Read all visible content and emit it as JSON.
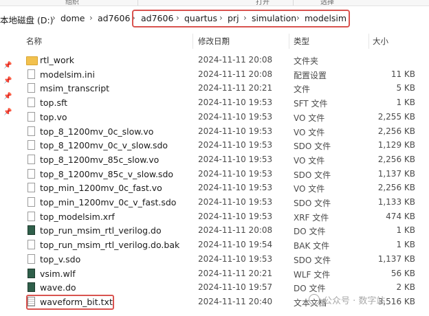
{
  "ribbon": {
    "groups": [
      "组织",
      "打开",
      "选择"
    ]
  },
  "breadcrumb": {
    "items": [
      "本地磁盘 (D:)",
      "dome",
      "ad7606",
      "ad7606",
      "quartus",
      "prj",
      "simulation",
      "modelsim"
    ]
  },
  "columns": {
    "name": "名称",
    "date": "修改日期",
    "type": "类型",
    "size": "大小"
  },
  "files": [
    {
      "name": "rtl_work",
      "date": "2024-11-11 20:08",
      "type": "文件夹",
      "size": "",
      "icon": "folder-icon"
    },
    {
      "name": "modelsim.ini",
      "date": "2024-11-11 20:08",
      "type": "配置设置",
      "size": "11 KB",
      "icon": "file-icon"
    },
    {
      "name": "msim_transcript",
      "date": "2024-11-11 20:21",
      "type": "文件",
      "size": "5 KB",
      "icon": "file-icon"
    },
    {
      "name": "top.sft",
      "date": "2024-11-10 19:53",
      "type": "SFT 文件",
      "size": "1 KB",
      "icon": "file-icon"
    },
    {
      "name": "top.vo",
      "date": "2024-11-10 19:53",
      "type": "VO 文件",
      "size": "2,255 KB",
      "icon": "file-icon"
    },
    {
      "name": "top_8_1200mv_0c_slow.vo",
      "date": "2024-11-10 19:53",
      "type": "VO 文件",
      "size": "2,256 KB",
      "icon": "file-icon"
    },
    {
      "name": "top_8_1200mv_0c_v_slow.sdo",
      "date": "2024-11-10 19:53",
      "type": "SDO 文件",
      "size": "1,129 KB",
      "icon": "file-icon"
    },
    {
      "name": "top_8_1200mv_85c_slow.vo",
      "date": "2024-11-10 19:53",
      "type": "VO 文件",
      "size": "2,256 KB",
      "icon": "file-icon"
    },
    {
      "name": "top_8_1200mv_85c_v_slow.sdo",
      "date": "2024-11-10 19:53",
      "type": "SDO 文件",
      "size": "1,137 KB",
      "icon": "file-icon"
    },
    {
      "name": "top_min_1200mv_0c_fast.vo",
      "date": "2024-11-10 19:53",
      "type": "VO 文件",
      "size": "2,256 KB",
      "icon": "file-icon"
    },
    {
      "name": "top_min_1200mv_0c_v_fast.sdo",
      "date": "2024-11-10 19:53",
      "type": "SDO 文件",
      "size": "1,133 KB",
      "icon": "file-icon"
    },
    {
      "name": "top_modelsim.xrf",
      "date": "2024-11-10 19:53",
      "type": "XRF 文件",
      "size": "474 KB",
      "icon": "file-icon"
    },
    {
      "name": "top_run_msim_rtl_verilog.do",
      "date": "2024-11-11 20:08",
      "type": "DO 文件",
      "size": "1 KB",
      "icon": "script-icon"
    },
    {
      "name": "top_run_msim_rtl_verilog.do.bak",
      "date": "2024-11-10 19:54",
      "type": "BAK 文件",
      "size": "1 KB",
      "icon": "file-icon"
    },
    {
      "name": "top_v.sdo",
      "date": "2024-11-10 19:53",
      "type": "SDO 文件",
      "size": "1,137 KB",
      "icon": "file-icon"
    },
    {
      "name": "vsim.wlf",
      "date": "2024-11-11 20:21",
      "type": "WLF 文件",
      "size": "56 KB",
      "icon": "script-icon"
    },
    {
      "name": "wave.do",
      "date": "2024-11-10 19:57",
      "type": "DO 文件",
      "size": "2 KB",
      "icon": "script-icon"
    },
    {
      "name": "waveform_bit.txt",
      "date": "2024-11-11 20:40",
      "type": "文本文档",
      "size": "3,516 KB",
      "icon": "text-file-icon"
    }
  ],
  "watermark": {
    "text": "公众号 · 数字站"
  }
}
